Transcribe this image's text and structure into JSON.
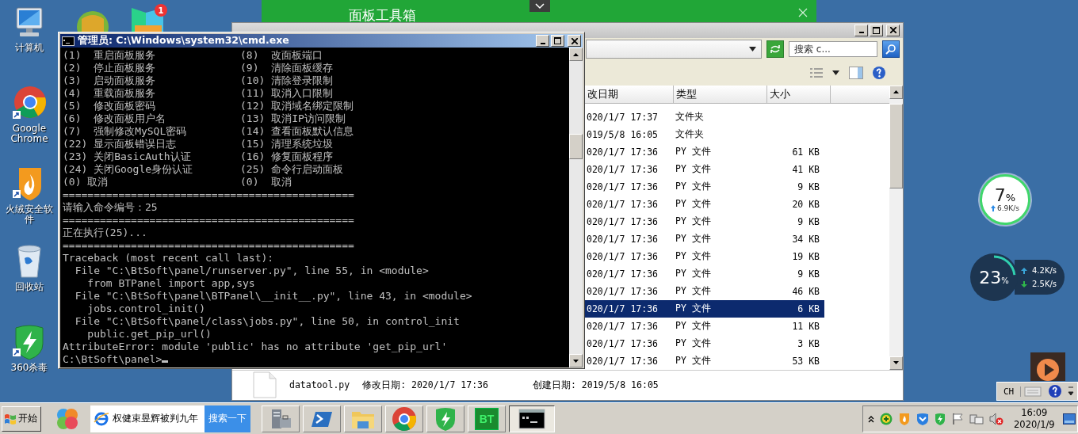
{
  "desktop_icons": [
    {
      "kind": "computer",
      "label": "计算机"
    },
    {
      "kind": "chrome",
      "label": "Google Chrome"
    },
    {
      "kind": "flame",
      "label": "火绒安全软件"
    },
    {
      "kind": "bin",
      "label": "回收站"
    },
    {
      "kind": "shield",
      "label": "360杀毒"
    }
  ],
  "covered_badge": "1",
  "toolbox_window": {
    "title": "面板工具箱"
  },
  "explorer": {
    "search_placeholder": "搜索 c...",
    "columns": [
      "改日期",
      "类型",
      "大小"
    ],
    "rows": [
      {
        "date": "020/1/7 17:37",
        "type": "文件夹",
        "size": "",
        "selected": false
      },
      {
        "date": "019/5/8 16:05",
        "type": "文件夹",
        "size": "",
        "selected": false
      },
      {
        "date": "020/1/7 17:36",
        "type": "PY 文件",
        "size": "61 KB",
        "selected": false
      },
      {
        "date": "020/1/7 17:36",
        "type": "PY 文件",
        "size": "41 KB",
        "selected": false
      },
      {
        "date": "020/1/7 17:36",
        "type": "PY 文件",
        "size": "9 KB",
        "selected": false
      },
      {
        "date": "020/1/7 17:36",
        "type": "PY 文件",
        "size": "20 KB",
        "selected": false
      },
      {
        "date": "020/1/7 17:36",
        "type": "PY 文件",
        "size": "9 KB",
        "selected": false
      },
      {
        "date": "020/1/7 17:36",
        "type": "PY 文件",
        "size": "34 KB",
        "selected": false
      },
      {
        "date": "020/1/7 17:36",
        "type": "PY 文件",
        "size": "19 KB",
        "selected": false
      },
      {
        "date": "020/1/7 17:36",
        "type": "PY 文件",
        "size": "9 KB",
        "selected": false
      },
      {
        "date": "020/1/7 17:36",
        "type": "PY 文件",
        "size": "46 KB",
        "selected": false
      },
      {
        "date": "020/1/7 17:36",
        "type": "PY 文件",
        "size": "6 KB",
        "selected": true
      },
      {
        "date": "020/1/7 17:36",
        "type": "PY 文件",
        "size": "11 KB",
        "selected": false
      },
      {
        "date": "020/1/7 17:36",
        "type": "PY 文件",
        "size": "3 KB",
        "selected": false
      },
      {
        "date": "020/1/7 17:36",
        "type": "PY 文件",
        "size": "53 KB",
        "selected": false
      }
    ],
    "details": {
      "file_name": "datatool.py",
      "modified": "修改日期: 2020/1/7 17:36",
      "created": "创建日期: 2019/5/8 16:05"
    }
  },
  "console": {
    "title": "管理员: C:\\Windows\\system32\\cmd.exe",
    "menu": [
      {
        "left": "(1)  重启面板服务",
        "right": "(8)  改面板端口"
      },
      {
        "left": "(2)  停止面板服务",
        "right": "(9)  清除面板缓存"
      },
      {
        "left": "(3)  启动面板服务",
        "right": "(10) 清除登录限制"
      },
      {
        "left": "(4)  重载面板服务",
        "right": "(11) 取消入口限制"
      },
      {
        "left": "(5)  修改面板密码",
        "right": "(12) 取消域名绑定限制"
      },
      {
        "left": "(6)  修改面板用户名",
        "right": "(13) 取消IP访问限制"
      },
      {
        "left": "(7)  强制修改MySQL密码",
        "right": "(14) 查看面板默认信息"
      },
      {
        "left": "(22) 显示面板错误日志",
        "right": "(15) 清理系统垃圾"
      },
      {
        "left": "(23) 关闭BasicAuth认证",
        "right": "(16) 修复面板程序"
      },
      {
        "left": "(24) 关闭Google身份认证",
        "right": "(25) 命令行启动面板"
      },
      {
        "left": "(0) 取消",
        "right": "(0)  取消"
      }
    ],
    "lines": [
      "===============================================",
      "请输入命令编号：25",
      "===============================================",
      "正在执行(25)...",
      "===============================================",
      "Traceback (most recent call last):",
      "  File \"C:\\BtSoft\\panel/runserver.py\", line 55, in <module>",
      "    from BTPanel import app,sys",
      "  File \"C:\\BtSoft\\panel\\BTPanel\\__init__.py\", line 43, in <module>",
      "    jobs.control_init()",
      "  File \"C:\\BtSoft\\panel/class\\jobs.py\", line 50, in control_init",
      "    public.get_pip_url()",
      "AttributeError: module 'public' has no attribute 'get_pip_url'"
    ],
    "prompt": "C:\\BtSoft\\panel>"
  },
  "cpu_widget": {
    "value": "7",
    "unit": "%",
    "speed": "6.9K/s"
  },
  "net_widget": {
    "value": "23",
    "unit": "%",
    "level": 0.23,
    "up": "4.2K/s",
    "down": "2.5K/s"
  },
  "language_bar": {
    "lang": "CH"
  },
  "taskbar": {
    "start": "开始",
    "search_text": "权健束昱辉被判九年",
    "search_button": "搜索一下",
    "apps": [
      {
        "kind": "server",
        "selected": false
      },
      {
        "kind": "powershell",
        "selected": false
      },
      {
        "kind": "folder",
        "selected": false
      },
      {
        "kind": "chrome",
        "selected": false
      },
      {
        "kind": "shield",
        "selected": false
      },
      {
        "kind": "bt",
        "label": "BT",
        "selected": false
      },
      {
        "kind": "console",
        "selected": true
      }
    ],
    "time": "16:09",
    "date": "2020/1/9"
  }
}
